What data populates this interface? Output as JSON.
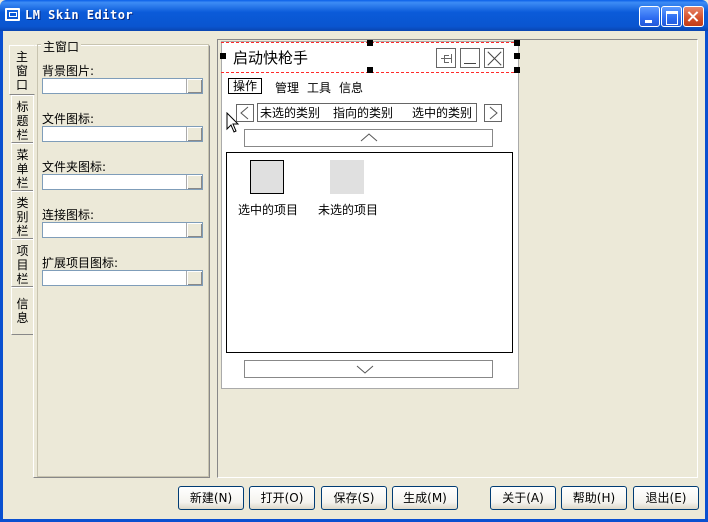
{
  "window": {
    "title": "LM Skin Editor"
  },
  "tabs": [
    {
      "label": "主窗口",
      "active": true
    },
    {
      "label": "标题栏"
    },
    {
      "label": "菜单栏"
    },
    {
      "label": "类别栏"
    },
    {
      "label": "项目栏"
    },
    {
      "label": "信息"
    }
  ],
  "panel": {
    "group_title": "主窗口",
    "fields": [
      {
        "label": "背景图片:",
        "value": ""
      },
      {
        "label": "文件图标:",
        "value": ""
      },
      {
        "label": "文件夹图标:",
        "value": ""
      },
      {
        "label": "连接图标:",
        "value": ""
      },
      {
        "label": "扩展项目图标:",
        "value": ""
      }
    ]
  },
  "preview": {
    "title": "启动快枪手",
    "menu": [
      "操作",
      "管理",
      "工具",
      "信息"
    ],
    "categories": [
      "未选的类别",
      "指向的类别",
      "选中的类别"
    ],
    "items": [
      {
        "label": "选中的项目"
      },
      {
        "label": "未选的项目"
      }
    ]
  },
  "buttons": {
    "new": "新建(N)",
    "open": "打开(O)",
    "save": "保存(S)",
    "generate": "生成(M)",
    "about": "关于(A)",
    "help": "帮助(H)",
    "exit": "退出(E)"
  },
  "colors": {
    "titlebar": "#0a5fe8",
    "window_bg": "#ece9d8",
    "selection_dash": "#ff2a2a"
  }
}
